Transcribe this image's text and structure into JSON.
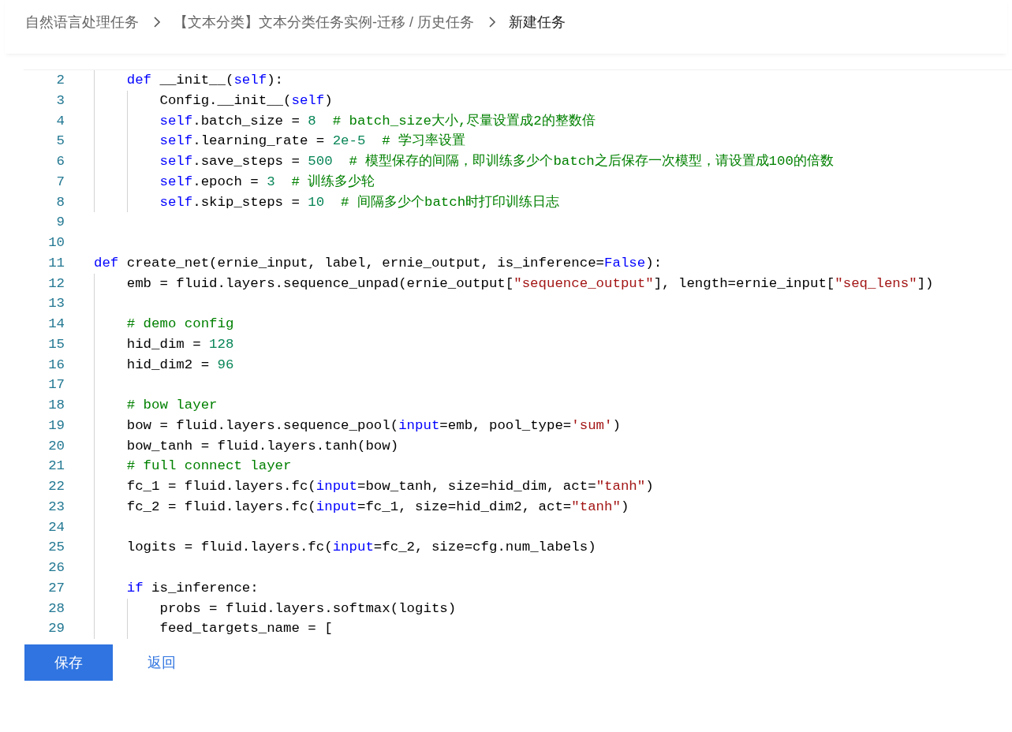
{
  "breadcrumb": [
    {
      "text": "自然语言处理任务",
      "current": false
    },
    {
      "text": "【文本分类】文本分类任务实例-迁移 / 历史任务",
      "current": false
    },
    {
      "text": "新建任务",
      "current": true
    }
  ],
  "editor": {
    "lines": [
      {
        "number": "2",
        "tokens": [
          {
            "kind": "keyword",
            "text": "    def"
          },
          {
            "kind": "plain",
            "text": " __init__("
          },
          {
            "kind": "keyword",
            "text": "self"
          },
          {
            "kind": "plain",
            "text": "):"
          }
        ]
      },
      {
        "number": "3",
        "tokens": [
          {
            "kind": "plain",
            "text": "        Config.__init__("
          },
          {
            "kind": "keyword",
            "text": "self"
          },
          {
            "kind": "plain",
            "text": ")"
          }
        ]
      },
      {
        "number": "4",
        "tokens": [
          {
            "kind": "keyword",
            "text": "        self"
          },
          {
            "kind": "plain",
            "text": ".batch_size = "
          },
          {
            "kind": "number",
            "text": "8"
          },
          {
            "kind": "comment",
            "text": "  # batch_size大小,尽量设置成2的整数倍"
          }
        ]
      },
      {
        "number": "5",
        "tokens": [
          {
            "kind": "keyword",
            "text": "        self"
          },
          {
            "kind": "plain",
            "text": ".learning_rate = "
          },
          {
            "kind": "number",
            "text": "2e-5"
          },
          {
            "kind": "comment",
            "text": "  # 学习率设置"
          }
        ]
      },
      {
        "number": "6",
        "tokens": [
          {
            "kind": "keyword",
            "text": "        self"
          },
          {
            "kind": "plain",
            "text": ".save_steps = "
          },
          {
            "kind": "number",
            "text": "500"
          },
          {
            "kind": "comment",
            "text": "  # 模型保存的间隔，即训练多少个batch之后保存一次模型，请设置成100的倍数"
          }
        ]
      },
      {
        "number": "7",
        "tokens": [
          {
            "kind": "keyword",
            "text": "        self"
          },
          {
            "kind": "plain",
            "text": ".epoch = "
          },
          {
            "kind": "number",
            "text": "3"
          },
          {
            "kind": "comment",
            "text": "  # 训练多少轮"
          }
        ]
      },
      {
        "number": "8",
        "tokens": [
          {
            "kind": "keyword",
            "text": "        self"
          },
          {
            "kind": "plain",
            "text": ".skip_steps = "
          },
          {
            "kind": "number",
            "text": "10"
          },
          {
            "kind": "comment",
            "text": "  # 间隔多少个batch时打印训练日志"
          }
        ]
      },
      {
        "number": "9"
      },
      {
        "number": "10"
      },
      {
        "number": "11",
        "tokens": [
          {
            "kind": "keyword",
            "text": "def"
          },
          {
            "kind": "plain",
            "text": " create_net(ernie_input, label, ernie_output, is_inference="
          },
          {
            "kind": "keyword",
            "text": "False"
          },
          {
            "kind": "plain",
            "text": "):"
          }
        ]
      },
      {
        "number": "12",
        "tokens": [
          {
            "kind": "plain",
            "text": "    emb = fluid.layers.sequence_unpad(ernie_output["
          },
          {
            "kind": "string",
            "text": "\"sequence_output\""
          },
          {
            "kind": "plain",
            "text": "], length=ernie_input["
          },
          {
            "kind": "string",
            "text": "\"seq_lens\""
          },
          {
            "kind": "plain",
            "text": "])"
          }
        ]
      },
      {
        "number": "13"
      },
      {
        "number": "14",
        "tokens": [
          {
            "kind": "comment",
            "text": "    # demo config"
          }
        ]
      },
      {
        "number": "15",
        "tokens": [
          {
            "kind": "plain",
            "text": "    hid_dim = "
          },
          {
            "kind": "number",
            "text": "128"
          }
        ]
      },
      {
        "number": "16",
        "tokens": [
          {
            "kind": "plain",
            "text": "    hid_dim2 = "
          },
          {
            "kind": "number",
            "text": "96"
          }
        ]
      },
      {
        "number": "17"
      },
      {
        "number": "18",
        "tokens": [
          {
            "kind": "comment",
            "text": "    # bow layer"
          }
        ]
      },
      {
        "number": "19",
        "tokens": [
          {
            "kind": "plain",
            "text": "    bow = fluid.layers.sequence_pool("
          },
          {
            "kind": "keyword",
            "text": "input"
          },
          {
            "kind": "plain",
            "text": "=emb, pool_type="
          },
          {
            "kind": "string",
            "text": "'sum'"
          },
          {
            "kind": "plain",
            "text": ")"
          }
        ]
      },
      {
        "number": "20",
        "tokens": [
          {
            "kind": "plain",
            "text": "    bow_tanh = fluid.layers.tanh(bow)"
          }
        ]
      },
      {
        "number": "21",
        "tokens": [
          {
            "kind": "comment",
            "text": "    # full connect layer"
          }
        ]
      },
      {
        "number": "22",
        "tokens": [
          {
            "kind": "plain",
            "text": "    fc_1 = fluid.layers.fc("
          },
          {
            "kind": "keyword",
            "text": "input"
          },
          {
            "kind": "plain",
            "text": "=bow_tanh, size=hid_dim, act="
          },
          {
            "kind": "string",
            "text": "\"tanh\""
          },
          {
            "kind": "plain",
            "text": ")"
          }
        ]
      },
      {
        "number": "23",
        "tokens": [
          {
            "kind": "plain",
            "text": "    fc_2 = fluid.layers.fc("
          },
          {
            "kind": "keyword",
            "text": "input"
          },
          {
            "kind": "plain",
            "text": "=fc_1, size=hid_dim2, act="
          },
          {
            "kind": "string",
            "text": "\"tanh\""
          },
          {
            "kind": "plain",
            "text": ")"
          }
        ]
      },
      {
        "number": "24"
      },
      {
        "number": "25",
        "tokens": [
          {
            "kind": "plain",
            "text": "    logits = fluid.layers.fc("
          },
          {
            "kind": "keyword",
            "text": "input"
          },
          {
            "kind": "plain",
            "text": "=fc_2, size=cfg.num_labels)"
          }
        ]
      },
      {
        "number": "26"
      },
      {
        "number": "27",
        "tokens": [
          {
            "kind": "keyword",
            "text": "    if"
          },
          {
            "kind": "plain",
            "text": " is_inference:"
          }
        ]
      },
      {
        "number": "28",
        "tokens": [
          {
            "kind": "plain",
            "text": "        probs = fluid.layers.softmax(logits)"
          }
        ]
      },
      {
        "number": "29",
        "tokens": [
          {
            "kind": "plain",
            "text": "        feed_targets_name = ["
          }
        ]
      }
    ]
  },
  "buttons": [
    {
      "label": "保存",
      "kind": "primary"
    },
    {
      "label": "返回",
      "kind": "link"
    }
  ]
}
